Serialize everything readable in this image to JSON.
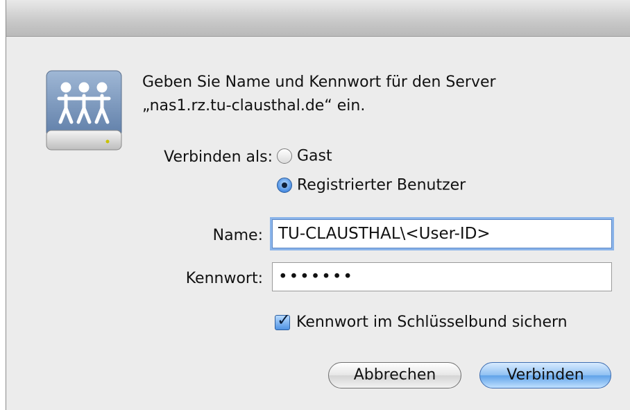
{
  "dialog": {
    "prompt_line1": "Geben Sie Name und Kennwort für den Server",
    "prompt_line2": "„nas1.rz.tu-clausthal.de“ ein.",
    "connect_as_label": "Verbinden als:",
    "options": [
      {
        "label": "Gast",
        "selected": false
      },
      {
        "label": "Registrierter Benutzer",
        "selected": true
      }
    ],
    "name_label": "Name:",
    "name_value": "TU-CLAUSTHAL\\<User-ID>",
    "password_label": "Kennwort:",
    "password_value": "•••••••",
    "keychain_label": "Kennwort im Schlüsselbund sichern",
    "keychain_checked": true,
    "cancel_label": "Abbrechen",
    "connect_label": "Verbinden"
  },
  "colors": {
    "accent": "#4a8de2",
    "dialog_bg": "#ececec"
  },
  "icons": {
    "server": "network-server-drive-icon"
  }
}
